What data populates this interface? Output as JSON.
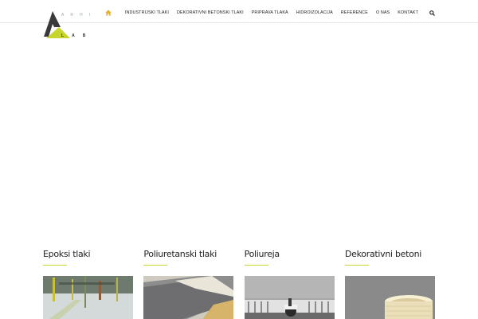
{
  "brand": {
    "letters_top": [
      "A",
      "R",
      "H",
      "I"
    ],
    "letters_bottom": [
      "L",
      "A",
      "B"
    ],
    "accent_color": "#c7d62e",
    "dark_color": "#3a3a3a"
  },
  "nav": {
    "home_icon": "home-icon",
    "items": [
      {
        "label": "INDUSTRIJSKI TLAKI"
      },
      {
        "label": "DEKORATIVNI BETONSKI TLAKI"
      },
      {
        "label": "PRIPRAVA TLAKA"
      },
      {
        "label": "HIDROIZOLACIJA"
      },
      {
        "label": "REFERENCE"
      },
      {
        "label": "O NAS"
      },
      {
        "label": "KONTAKT"
      }
    ],
    "search_icon": "search-icon"
  },
  "cards": [
    {
      "title": "Epoksi tlaki",
      "image": "epoxy-floor-photo"
    },
    {
      "title": "Poliuretanski tlaki",
      "image": "polyurethane-floor-photo"
    },
    {
      "title": "Poliureja",
      "image": "polyurea-photo"
    },
    {
      "title": "Dekorativni betoni",
      "image": "decorative-concrete-photo"
    }
  ]
}
